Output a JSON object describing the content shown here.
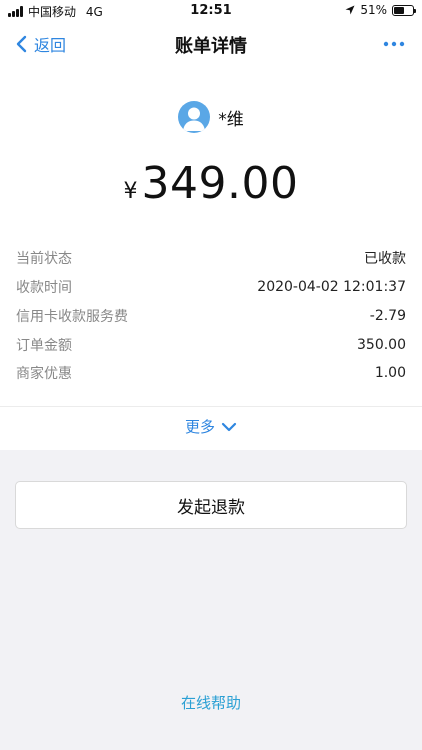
{
  "status_bar": {
    "carrier": "中国移动",
    "network": "4G",
    "time": "12:51",
    "battery": "51%"
  },
  "nav": {
    "back_label": "返回",
    "title": "账单详情"
  },
  "payer": {
    "name": "*维"
  },
  "amount": {
    "currency": "¥",
    "value": "349.00"
  },
  "details": [
    {
      "label": "当前状态",
      "value": "已收款"
    },
    {
      "label": "收款时间",
      "value": "2020-04-02 12:01:37"
    },
    {
      "label": "信用卡收款服务费",
      "value": "-2.79"
    },
    {
      "label": "订单金额",
      "value": "350.00"
    },
    {
      "label": "商家优惠",
      "value": "1.00"
    }
  ],
  "more_label": "更多",
  "refund_label": "发起退款",
  "help_label": "在线帮助",
  "colors": {
    "accent": "#2f86e0",
    "help": "#2ba0d4",
    "background": "#f2f2f5"
  }
}
